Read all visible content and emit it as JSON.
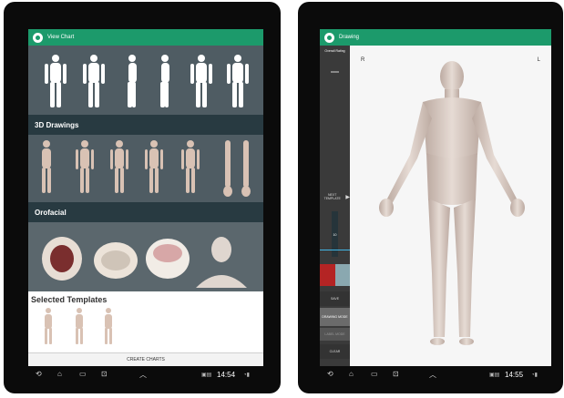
{
  "left_screen": {
    "title": "View Chart",
    "sections": [
      {
        "label": "3D Drawings"
      },
      {
        "label": "Orofacial"
      }
    ],
    "selected_templates_title": "Selected Templates",
    "create_button": "CREATE CHARTS",
    "time": "14:54"
  },
  "right_screen": {
    "title": "Drawing",
    "overall_rating_label": "Overall Rating",
    "next_template_label": "NEXT TEMPLATE",
    "slider_value": "10",
    "save_label": "SAVE",
    "drawing_mode_label": "DRAWING MODE",
    "label_mode_label": "LABEL MODE",
    "clear_label": "CLEAR",
    "right_marker": "R",
    "left_marker": "L",
    "time": "14:55"
  },
  "colors": {
    "brand": "#1c9a6b",
    "panel_dark": "#283a41",
    "swatch_red": "#b42424",
    "swatch_teal": "#8aa8b0"
  }
}
